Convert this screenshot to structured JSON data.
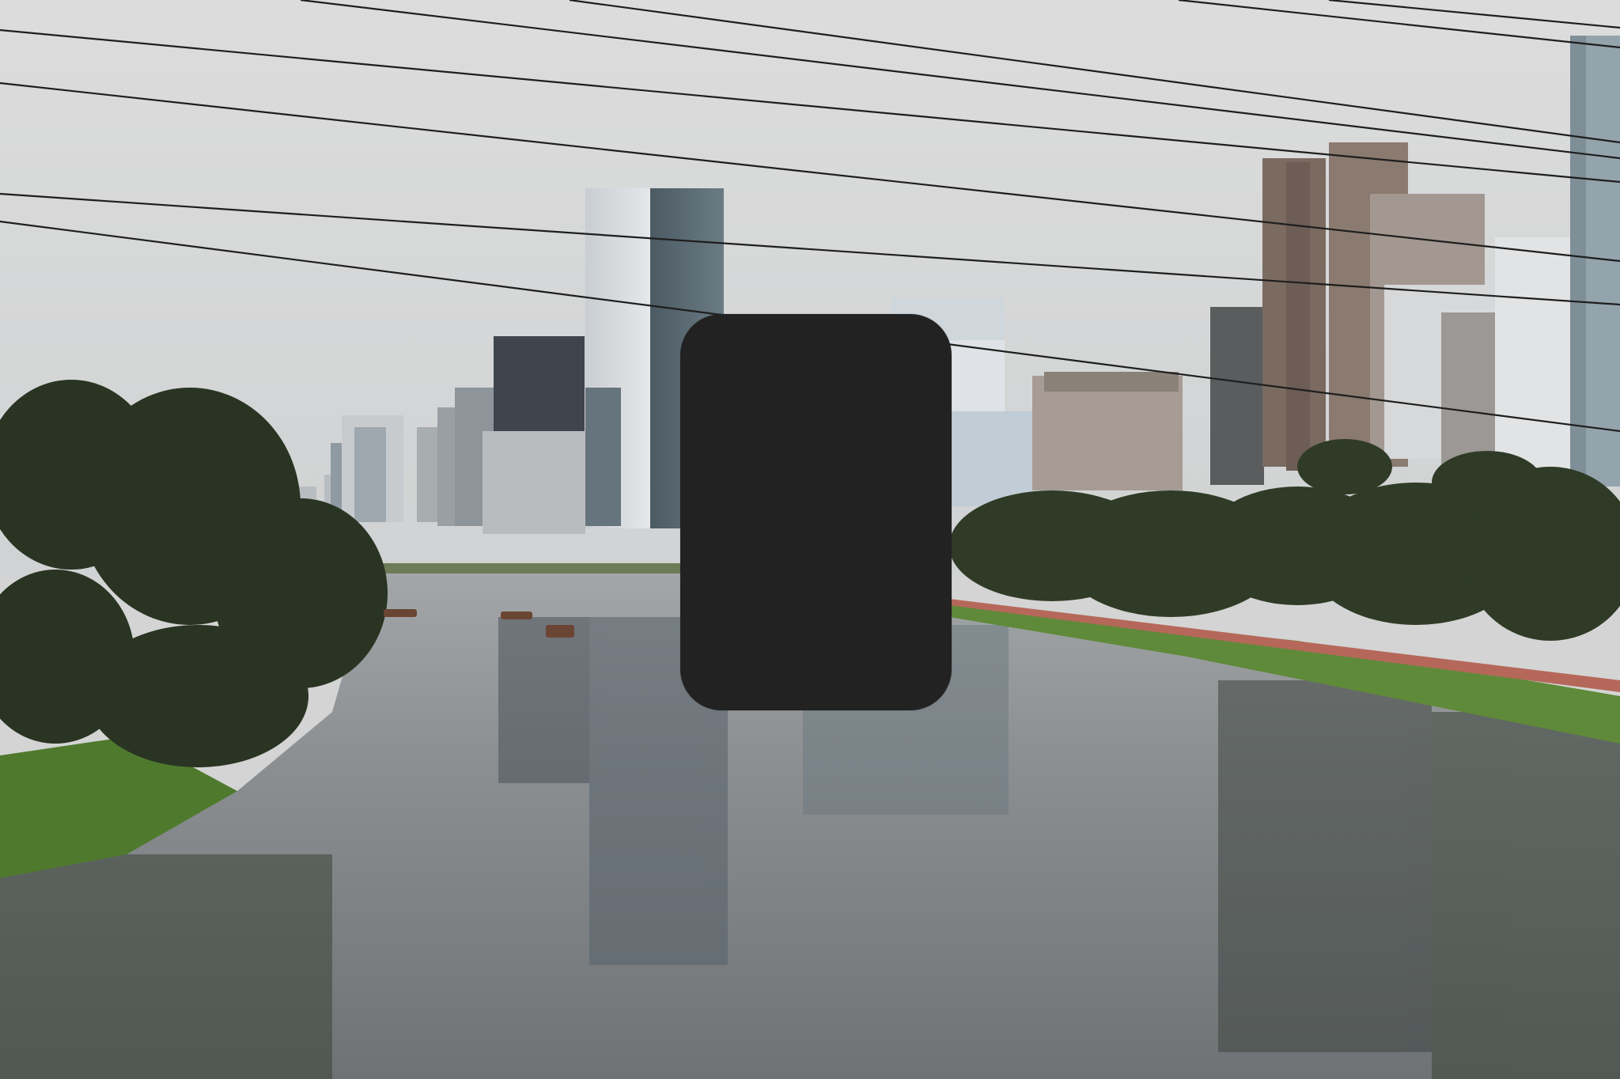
{
  "photo": {
    "subject": "river-skyline-photo",
    "colors": {
      "sky": "#d9d9d9",
      "haze": "#cfd1d3",
      "water": "#8c8f92",
      "grass": "#5f8a3a",
      "foliage": "#2f3b26",
      "walkway": "#b5685a"
    }
  },
  "overlay": {
    "color": "#222222"
  }
}
